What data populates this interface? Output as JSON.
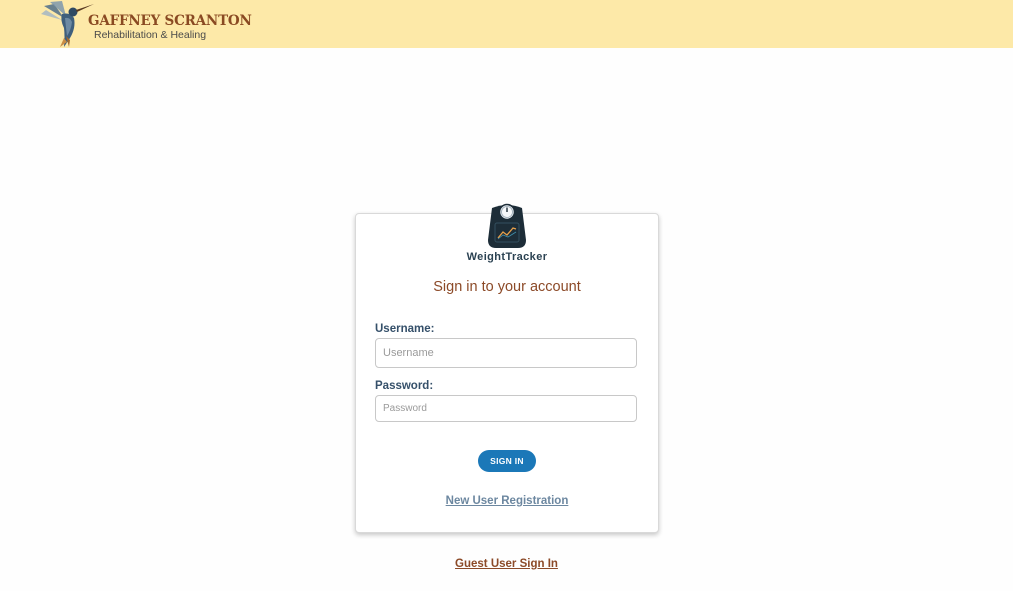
{
  "header": {
    "brand_name": "GAFFNEY SCRANTON",
    "brand_tagline": "Rehabilitation & Healing",
    "background_color": "#fde9a8",
    "logo_icon": "hummingbird-logo"
  },
  "login": {
    "app_icon": "weight-scale-icon",
    "app_name": "WeightTracker",
    "heading": "Sign in to your account",
    "username_label": "Username:",
    "username_placeholder": "Username",
    "username_value": "",
    "password_label": "Password:",
    "password_placeholder": "Password",
    "password_value": "",
    "signin_label": "SIGN IN",
    "register_link": "New User Registration",
    "accent_color": "#1b78b8"
  },
  "footer": {
    "guest_link": "Guest User Sign In"
  }
}
